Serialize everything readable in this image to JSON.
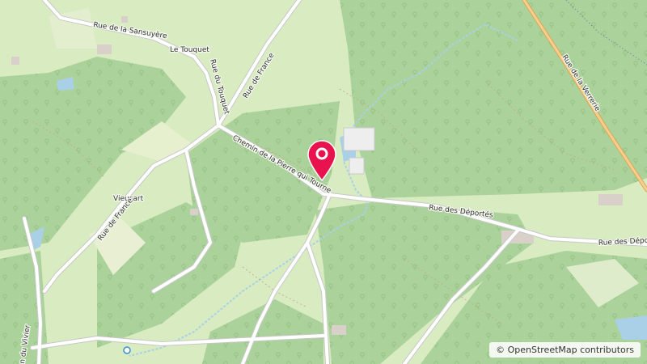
{
  "map": {
    "colors": {
      "forest": "#acd29c",
      "meadow": "#d8ebc1",
      "road": "#ffffff",
      "major_road": "#f2c27a",
      "water": "#a9d0e6",
      "marker": "#e8124f"
    },
    "road_labels": {
      "rue_sansuyere": "Rue de la Sansuyère",
      "le_touquet": "Le Touquet",
      "rue_du_touquet": "Rue du Touquet",
      "rue_de_france_top": "Rue de France",
      "rue_de_la_verrerie": "Rue de la Verrerie",
      "chemin_pierre": "Chemin de la Pierre qui Tourne",
      "rue_des_deportes": "Rue des Déportés",
      "rue_des_deportes_right": "Rue des Déporté",
      "vieusart": "Vieusart",
      "rue_de_france_left": "Rue de France",
      "rue_du_vivier": "n du Vivier"
    },
    "marker_icon": "map-pin-icon",
    "attribution": {
      "symbol": "©",
      "text": "OpenStreetMap contributors"
    }
  }
}
